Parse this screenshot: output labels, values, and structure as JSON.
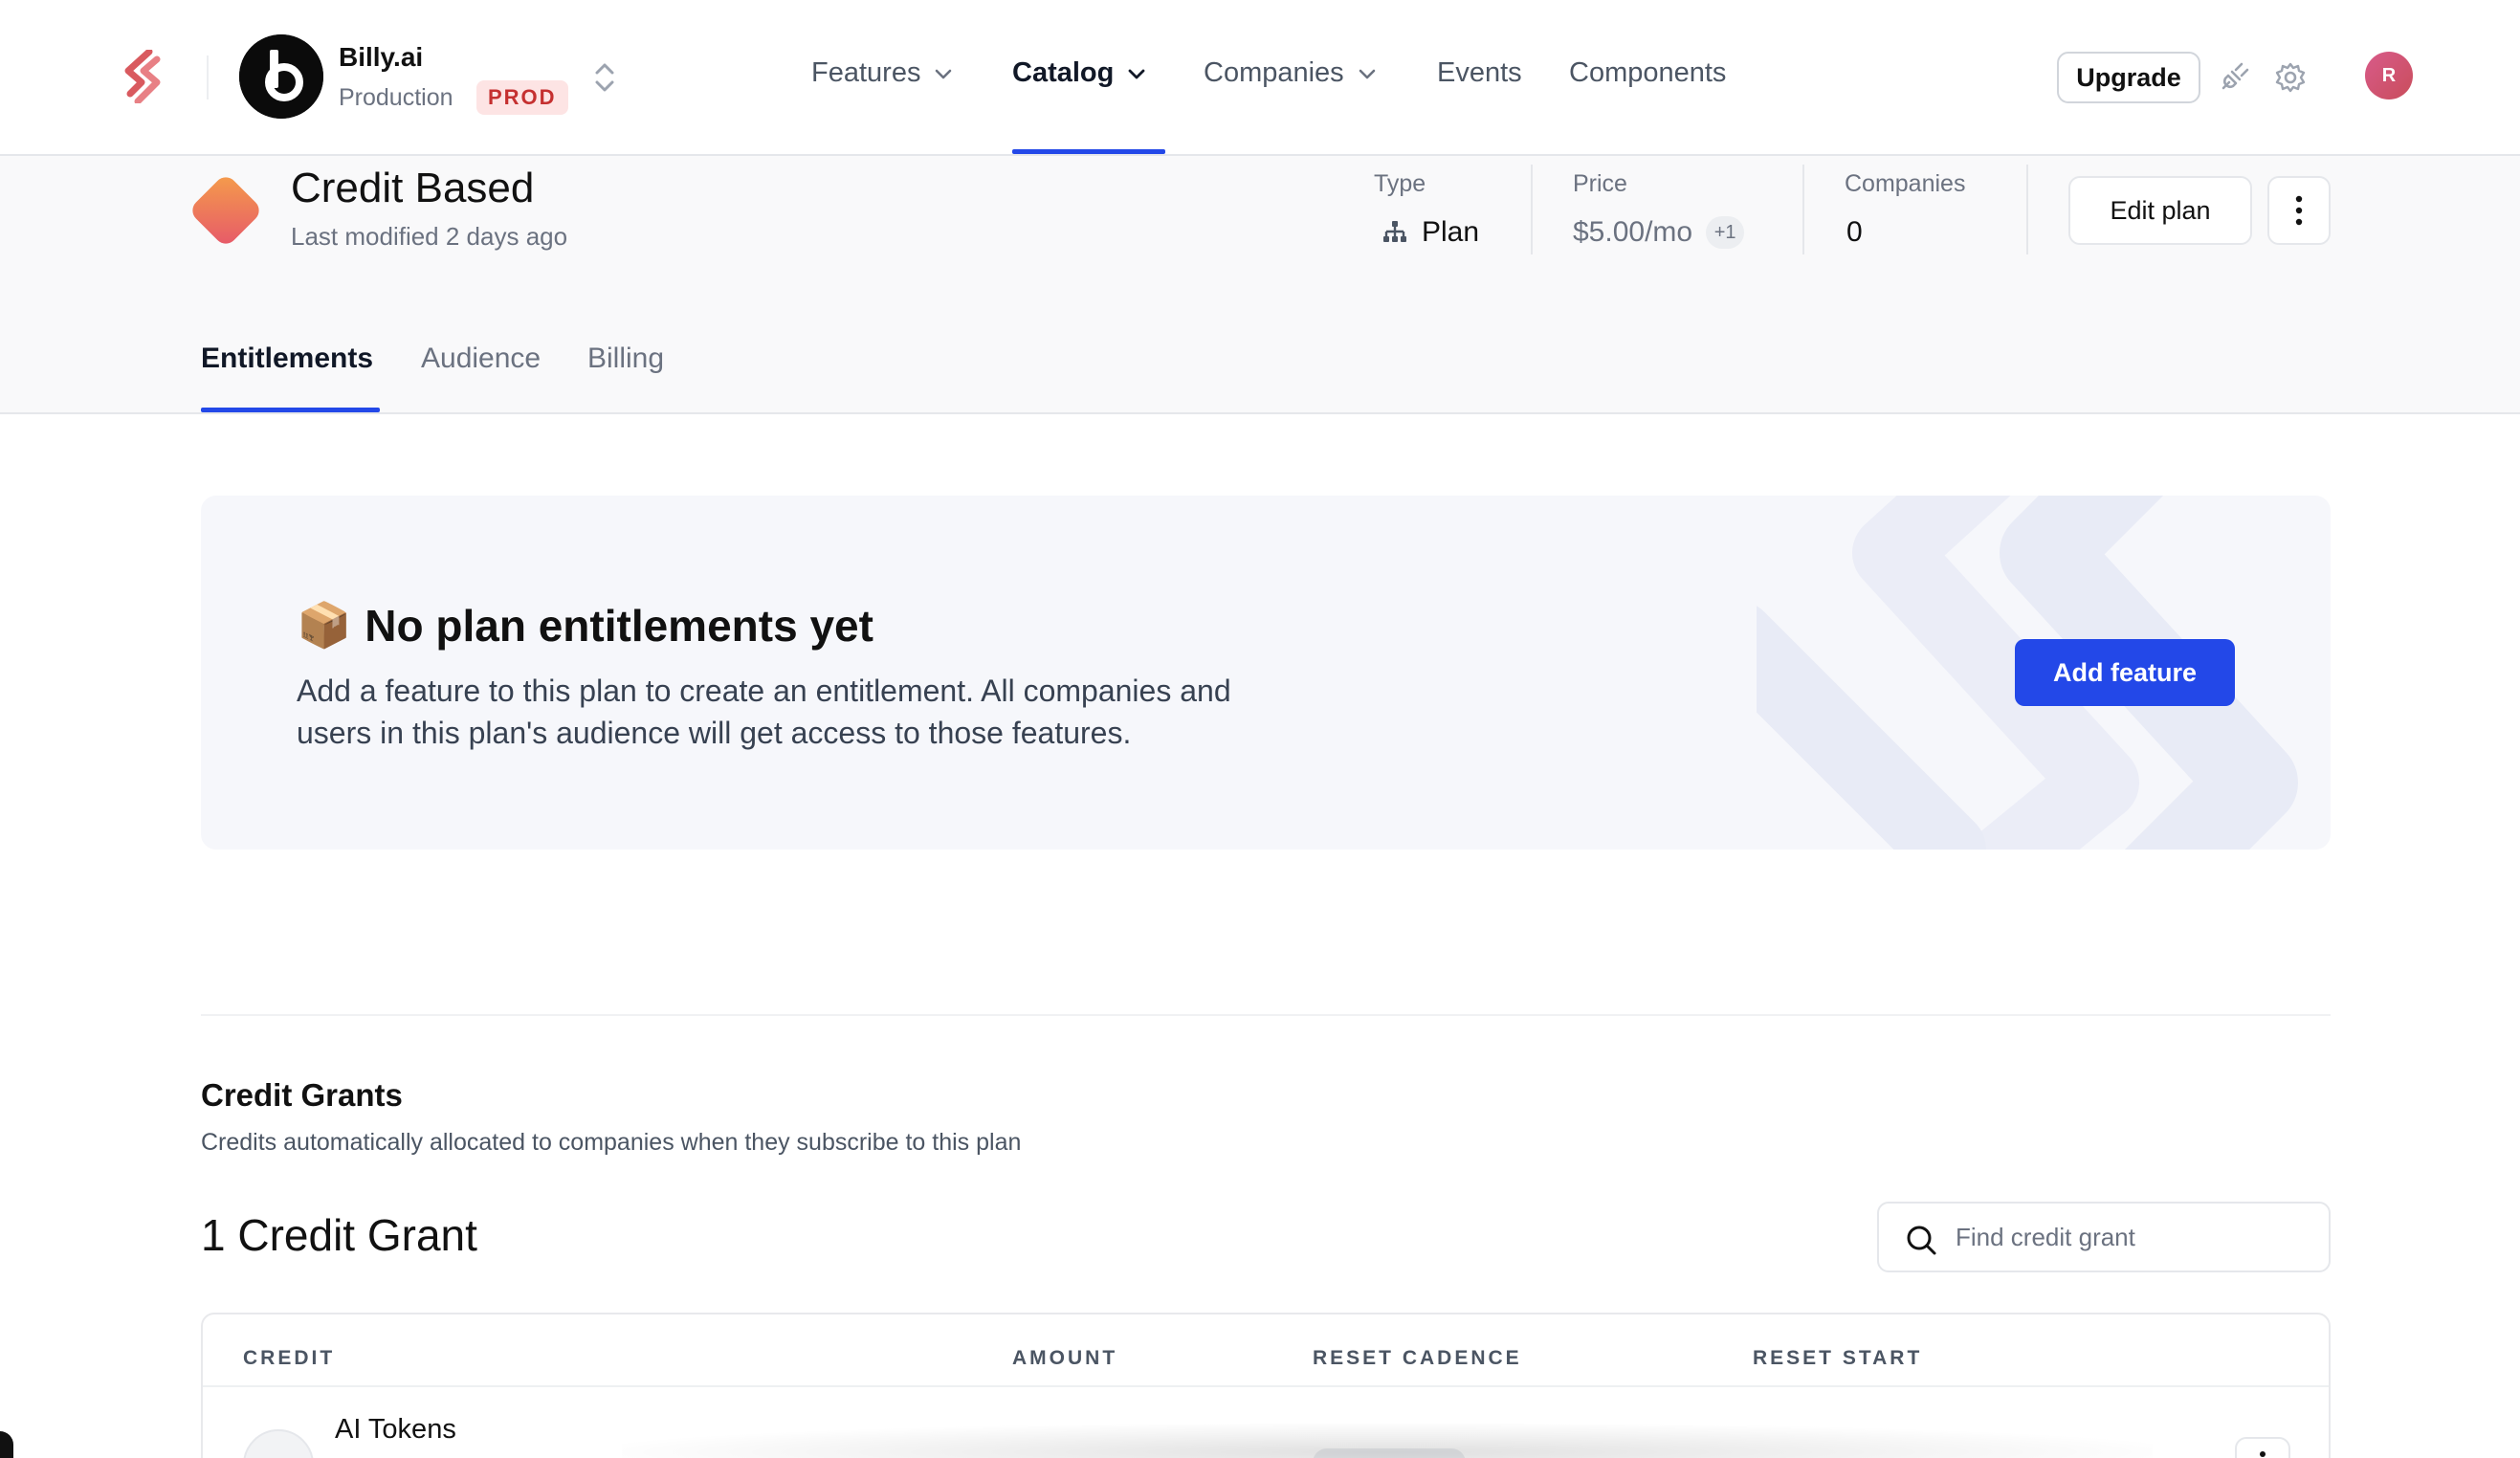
{
  "nav": {
    "org_name": "Billy.ai",
    "environment": "Production",
    "environment_badge": "PROD",
    "items": [
      {
        "label": "Features",
        "has_menu": true
      },
      {
        "label": "Catalog",
        "has_menu": true,
        "active": true
      },
      {
        "label": "Companies",
        "has_menu": true
      },
      {
        "label": "Events",
        "has_menu": false
      },
      {
        "label": "Components",
        "has_menu": false
      }
    ],
    "upgrade_label": "Upgrade",
    "user_initial": "R"
  },
  "plan": {
    "name": "Credit Based",
    "last_modified": "Last modified 2 days ago",
    "type_label": "Type",
    "type_value": "Plan",
    "price_label": "Price",
    "price_value": "$5.00/mo",
    "price_extra": "+1",
    "companies_label": "Companies",
    "companies_value": "0",
    "edit_label": "Edit plan"
  },
  "tabs": [
    {
      "label": "Entitlements",
      "active": true
    },
    {
      "label": "Audience"
    },
    {
      "label": "Billing"
    }
  ],
  "empty_state": {
    "emoji": "📦",
    "title": "No plan entitlements yet",
    "description": "Add a feature to this plan to create an entitlement. All companies and users in this plan's audience will get access to those features.",
    "button_label": "Add feature"
  },
  "credit_grants": {
    "title": "Credit Grants",
    "subtitle": "Credits automatically allocated to companies when they subscribe to this plan",
    "count_label": "1 Credit Grant",
    "search_placeholder": "Find credit grant",
    "columns": [
      "CREDIT",
      "AMOUNT",
      "RESET CADENCE",
      "RESET START"
    ],
    "rows": [
      {
        "credit": "AI Tokens"
      }
    ]
  },
  "colors": {
    "accent": "#2348e8",
    "prod_badge_bg": "#fde4e4",
    "prod_badge_text": "#c53030"
  }
}
